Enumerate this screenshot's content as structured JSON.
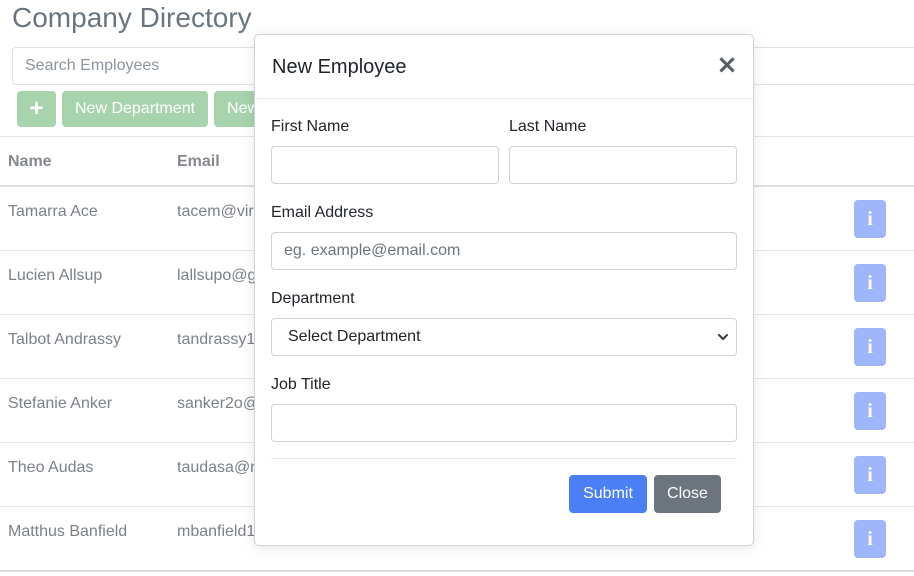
{
  "page": {
    "title": "Company Directory",
    "search_placeholder": "Search Employees",
    "toolbar": {
      "add_label": "+",
      "new_department_label": "New Department",
      "new_partial_label": "New"
    },
    "table": {
      "headers": {
        "name": "Name",
        "email": "Email"
      },
      "rows": [
        {
          "name": "Tamarra Ace",
          "email": "tacem@vir"
        },
        {
          "name": "Lucien Allsup",
          "email": "lallsupo@g"
        },
        {
          "name": "Talbot Andrassy",
          "email": "tandrassy1"
        },
        {
          "name": "Stefanie Anker",
          "email": "sanker2o@"
        },
        {
          "name": "Theo Audas",
          "email": "taudasa@n"
        },
        {
          "name": "Matthus Banfield",
          "email": "mbanfield1"
        }
      ],
      "info_icon": "i"
    }
  },
  "modal": {
    "title": "New Employee",
    "close_icon": "×",
    "first_name_label": "First Name",
    "last_name_label": "Last Name",
    "email_label": "Email Address",
    "email_placeholder": "eg. example@email.com",
    "department_label": "Department",
    "department_selected": "Select Department",
    "job_title_label": "Job Title",
    "submit_label": "Submit",
    "close_label": "Close"
  },
  "colors": {
    "toolbar_button": "#a7d4ad",
    "info_button": "#9fb6fb",
    "submit_button": "#4a7ff6",
    "close_button": "#6c757d"
  }
}
